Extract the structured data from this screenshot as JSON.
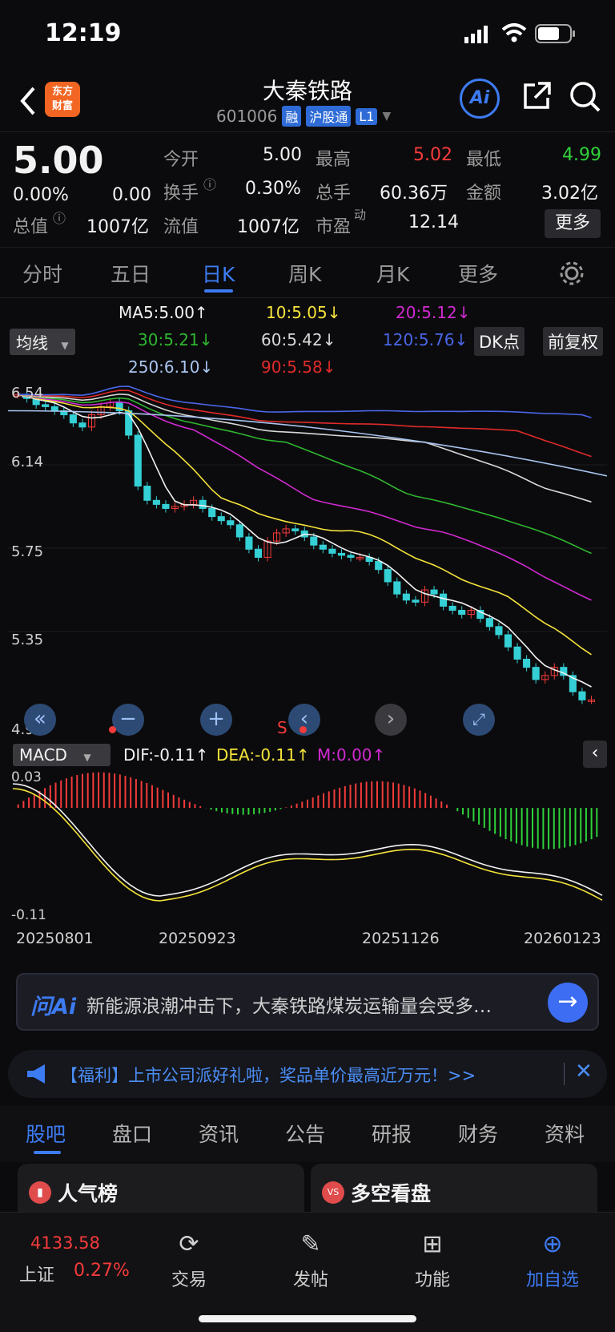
{
  "status": {
    "time": "12:19"
  },
  "header": {
    "title": "大秦铁路",
    "code": "601006",
    "tags": [
      "融",
      "沪股通",
      "L1"
    ],
    "logo": "东方\n财富",
    "ai": "Ai"
  },
  "quote": {
    "price": "5.00",
    "change_pct": "0.00%",
    "change": "0.00",
    "rows": [
      [
        {
          "label": "今开",
          "value": "5.00"
        },
        {
          "label": "最高",
          "value": "5.02"
        },
        {
          "label": "最低",
          "value": "4.99"
        }
      ],
      [
        {
          "label": "换手",
          "value": "0.30%"
        },
        {
          "label": "总手",
          "value": "60.36万"
        },
        {
          "label": "金额",
          "value": "3.02亿"
        }
      ]
    ],
    "total_value_label": "总值",
    "total_value": "1007亿",
    "float_label": "流值",
    "float_value": "1007亿",
    "pe_label": "市盈",
    "pe_sup": "动",
    "pe_value": "12.14",
    "more": "更多"
  },
  "period_tabs": [
    "分时",
    "五日",
    "日K",
    "周K",
    "月K",
    "更多"
  ],
  "active_period": "日K",
  "ma": {
    "select": "均线",
    "items": [
      {
        "text": "MA5:5.00↑",
        "color": "#f2f2f2"
      },
      {
        "text": "10:5.05↓",
        "color": "#f5e33b"
      },
      {
        "text": "20:5.12↓",
        "color": "#d02ad0"
      },
      {
        "text": "30:5.21↓",
        "color": "#2fb52f"
      },
      {
        "text": "60:5.42↓",
        "color": "#d8d8d8"
      },
      {
        "text": "120:5.76↓",
        "color": "#4a66e8"
      },
      {
        "text": "250:6.10↓",
        "color": "#a9c4f0"
      },
      {
        "text": "90:5.58↓",
        "color": "#e02a2a"
      }
    ],
    "dk": "DK点",
    "adjust": "前复权"
  },
  "chart_data": {
    "type": "candlestick",
    "y_ticks": [
      "6.54",
      "6.14",
      "5.75",
      "5.35",
      "4.95"
    ],
    "ylim": [
      4.95,
      6.54
    ],
    "close": [
      6.5,
      6.48,
      6.45,
      6.44,
      6.42,
      6.4,
      6.36,
      6.34,
      6.4,
      6.44,
      6.46,
      6.42,
      6.3,
      6.05,
      5.98,
      5.96,
      5.94,
      5.95,
      5.96,
      5.98,
      5.94,
      5.9,
      5.88,
      5.86,
      5.8,
      5.74,
      5.7,
      5.78,
      5.82,
      5.84,
      5.83,
      5.8,
      5.76,
      5.74,
      5.72,
      5.71,
      5.7,
      5.7,
      5.68,
      5.64,
      5.58,
      5.52,
      5.49,
      5.48,
      5.54,
      5.52,
      5.46,
      5.44,
      5.42,
      5.44,
      5.4,
      5.36,
      5.32,
      5.26,
      5.2,
      5.16,
      5.1,
      5.12,
      5.16,
      5.12,
      5.04,
      5.0,
      5.0
    ],
    "macd": {
      "dif": "-0.11",
      "dea": "-0.11",
      "m": "0.00",
      "yticks": [
        "0.03",
        "-0.11"
      ]
    },
    "dates": [
      "20250801",
      "20250923",
      "20251126",
      "20260123"
    ]
  },
  "macd_bar": {
    "select": "MACD",
    "dif": "DIF:-0.11↑",
    "dea": "DEA:-0.11↑",
    "m": "M:0.00↑"
  },
  "ai_bar": {
    "logo": "问Ai",
    "text": "新能源浪潮冲击下，大秦铁路煤炭运输量会受多…"
  },
  "promo": {
    "text": "【福利】上市公司派好礼啦，奖品单价最高近万元！>>"
  },
  "bottom_tabs": [
    "股吧",
    "盘口",
    "资讯",
    "公告",
    "研报",
    "财务",
    "资料"
  ],
  "cards": [
    "人气榜",
    "多空看盘"
  ],
  "nav": {
    "index_value": "4133.58",
    "index_name": "上证",
    "index_change": "0.27%",
    "items": [
      "交易",
      "发帖",
      "功能",
      "加自选"
    ]
  },
  "chart_markers": {
    "s": "S"
  }
}
